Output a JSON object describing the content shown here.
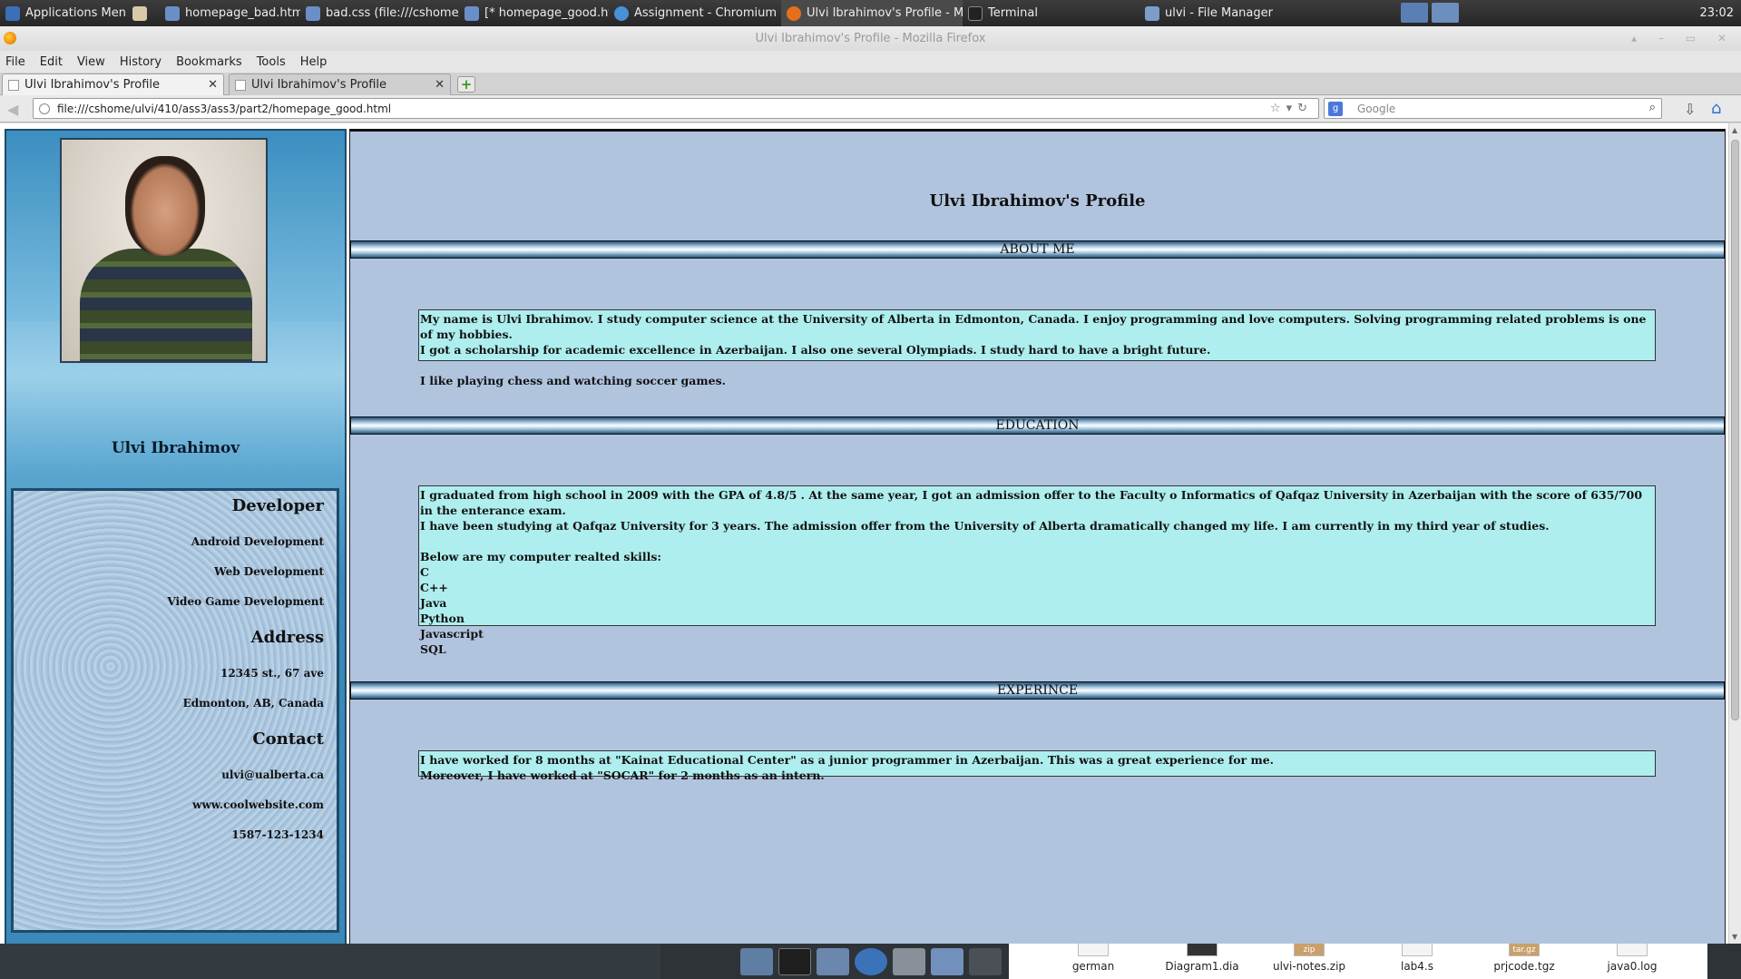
{
  "taskbar": {
    "apps_menu": "Applications Menu",
    "tasks": [
      "homepage_bad.html (file:...",
      "bad.css (file:///cshome/ulv...",
      "[* homepage_good.html (...",
      "Assignment - Chromium",
      "Ulvi Ibrahimov's Profile - M...",
      "Terminal",
      "ulvi - File Manager"
    ],
    "clock": "23:02"
  },
  "window": {
    "title": "Ulvi Ibrahimov's Profile - Mozilla Firefox",
    "menu": [
      "File",
      "Edit",
      "View",
      "History",
      "Bookmarks",
      "Tools",
      "Help"
    ],
    "tabs": [
      "Ulvi Ibrahimov's Profile",
      "Ulvi Ibrahimov's Profile"
    ],
    "url": "file:///cshome/ulvi/410/ass3/ass3/part2/homepage_good.html",
    "search_placeholder": "Google"
  },
  "sidebar": {
    "name": "Ulvi Ibrahimov",
    "sections": [
      {
        "heading": "Developer",
        "items": [
          "Android Development",
          "Web Development",
          "Video Game Development"
        ]
      },
      {
        "heading": "Address",
        "items": [
          "12345 st., 67 ave",
          "Edmonton, AB, Canada"
        ]
      },
      {
        "heading": "Contact",
        "items": [
          "ulvi@ualberta.ca",
          "www.coolwebsite.com",
          "1587-123-1234"
        ]
      }
    ]
  },
  "main": {
    "title": "Ulvi Ibrahimov's Profile",
    "about": {
      "heading": "ABOUT ME",
      "text": "My name is Ulvi Ibrahimov. I study computer science at the University of Alberta in Edmonton, Canada. I enjoy programming and love computers. Solving programming related problems is one of my hobbies.\nI got a scholarship for academic excellence in Azerbaijan. I also one several Olympiads. I study hard to have a bright future.\n\nI like playing chess and watching soccer games."
    },
    "education": {
      "heading": "EDUCATION",
      "text": "I graduated from high school in 2009 with the GPA of 4.8/5 . At the same year, I got an admission offer to the Faculty o Informatics of Qafqaz University in Azerbaijan with the score of 635/700 in the enterance exam.\nI have been studying at Qafqaz University for 3 years. The admission offer from the University of Alberta dramatically changed my life. I am currently in my third year of studies.\n\nBelow are my computer realted skills:\nC\nC++\nJava\nPython\nJavascript\nSQL"
    },
    "experience": {
      "heading": "EXPERINCE",
      "text": "I have worked for 8 months at \"Kainat Educational Center\" as a junior programmer in Azerbaijan. This was a great experience for me.\nMoreover, I have worked at \"SOCAR\" for 2 months as an intern."
    }
  },
  "desktop_files": [
    {
      "name": "german",
      "badge": ""
    },
    {
      "name": "Diagram1.dia",
      "badge": ""
    },
    {
      "name": "ulvi-notes.zip",
      "badge": "zip"
    },
    {
      "name": "lab4.s",
      "badge": ""
    },
    {
      "name": "prjcode.tgz",
      "badge": "tar.gz"
    },
    {
      "name": "java0.log",
      "badge": ""
    }
  ],
  "colors": {
    "main_bg": "#b0c4de",
    "box_bg": "#afeeee",
    "sidebar_blue": "#3a89b8"
  }
}
